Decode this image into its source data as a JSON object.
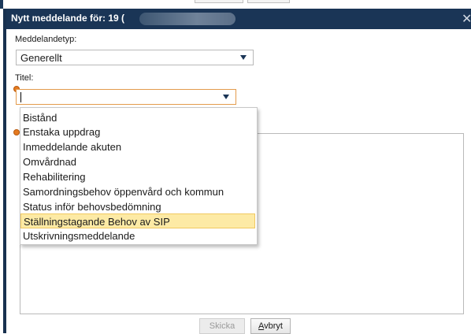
{
  "dialog": {
    "title": "Nytt meddelande för: 19 (",
    "close_glyph": "✕"
  },
  "form": {
    "type_label": "Meddelandetyp:",
    "type_value": "Generellt",
    "title_label": "Titel:",
    "title_value": ""
  },
  "dropdown": {
    "options": [
      "Bistånd",
      "Enstaka uppdrag",
      "Inmeddelande akuten",
      "Omvårdnad",
      "Rehabilitering",
      "Samordningsbehov öppenvård och kommun",
      "Status inför behovsbedömning",
      "Ställningstagande Behov av SIP",
      "Utskrivningsmeddelande"
    ],
    "highlighted": "Ställningstagande Behov av SIP"
  },
  "buttons": {
    "send_label": "Skicka",
    "cancel_label_first": "A",
    "cancel_label_rest": "vbryt"
  },
  "colors": {
    "titlebar": "#1a3556",
    "required": "#e57a20",
    "highlight": "#fdeaa5"
  }
}
